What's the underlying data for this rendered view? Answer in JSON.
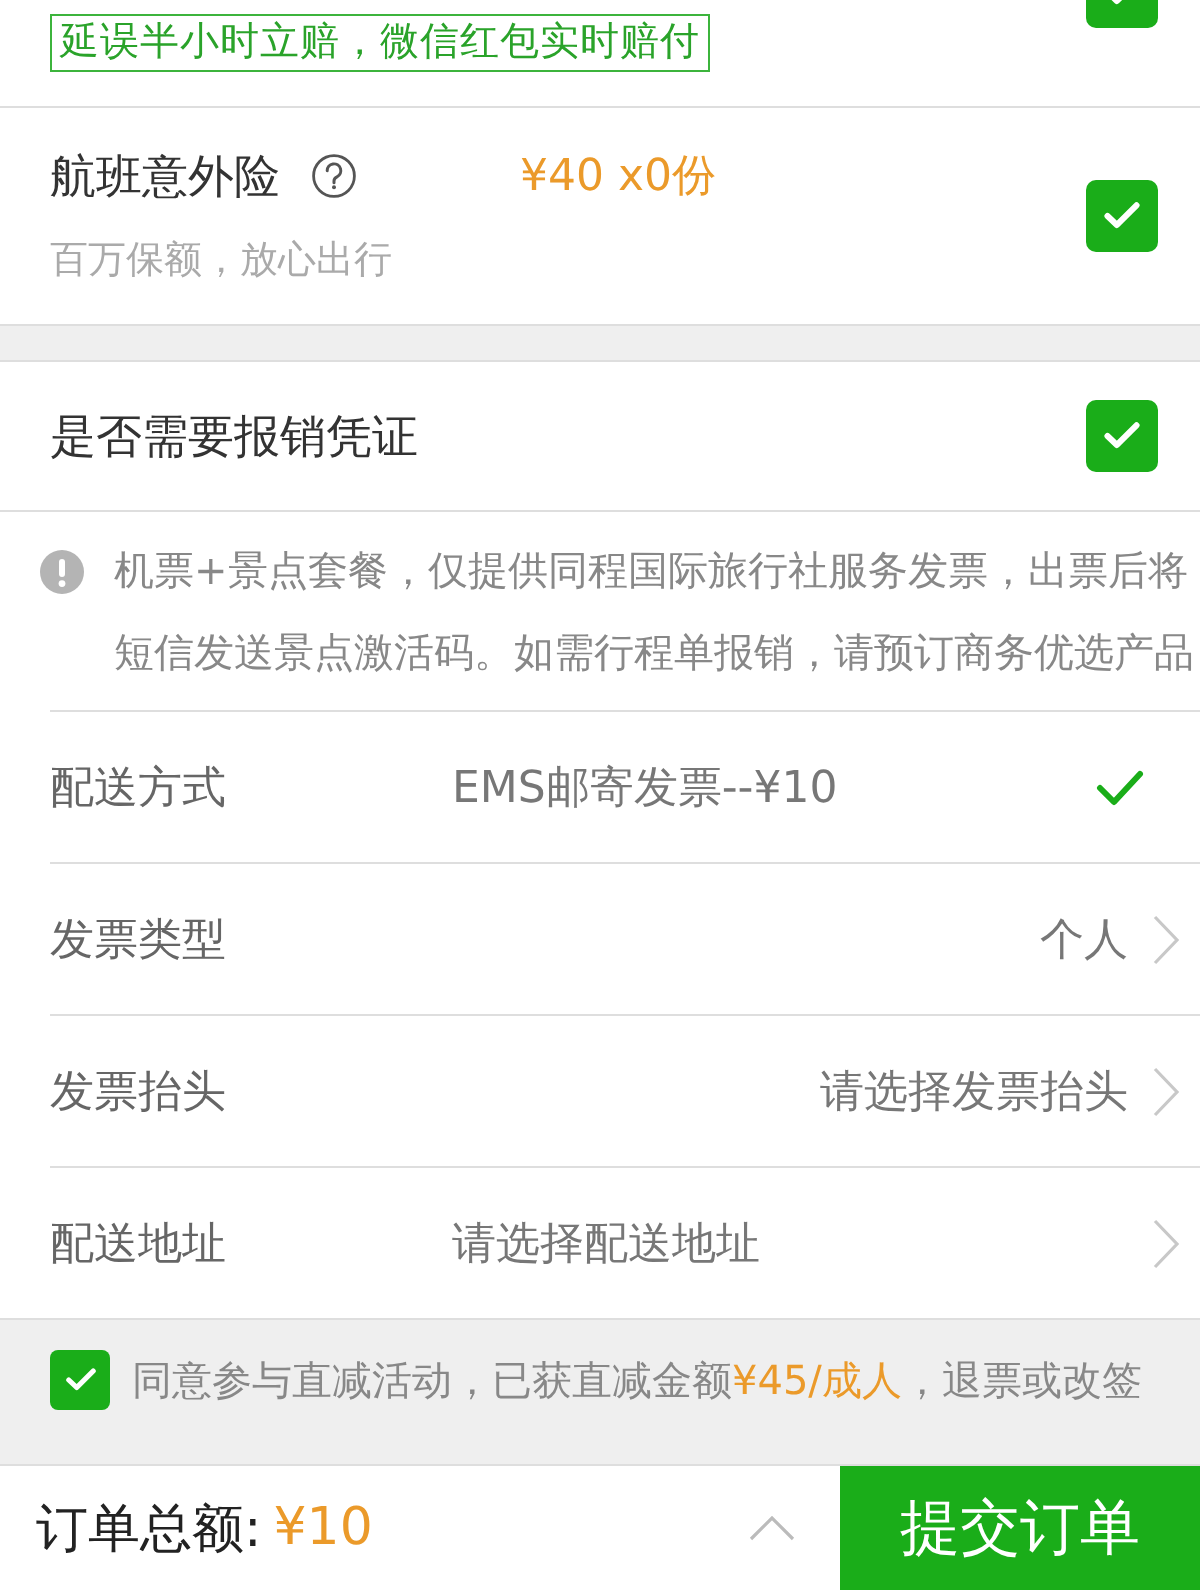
{
  "delay_compensation": {
    "tag": "延误半小时立赔，微信红包实时赔付",
    "checked": true
  },
  "accident_insurance": {
    "title": "航班意外险",
    "price": "¥40 x0份",
    "subtitle": "百万保额，放心出行",
    "checked": true
  },
  "reimbursement": {
    "label": "是否需要报销凭证",
    "checked": true
  },
  "notice": "机票+景点套餐，仅提供同程国际旅行社服务发票，出票后将短信发送景点激活码。如需行程单报销，请预订商务优选产品",
  "invoice_rows": [
    {
      "kind": "option",
      "label": "配送方式",
      "value": "EMS邮寄发票--¥10"
    },
    {
      "kind": "select",
      "label": "发票类型",
      "value": "个人"
    },
    {
      "kind": "select",
      "label": "发票抬头",
      "value": "请选择发票抬头"
    },
    {
      "kind": "entry",
      "label": "配送地址",
      "value": "请选择配送地址"
    }
  ],
  "agreement": {
    "checked": true,
    "parts": [
      {
        "text": "同意参与直减活动，已获直减金额",
        "highlight": false
      },
      {
        "text": "¥45/成人",
        "highlight": true
      },
      {
        "text": "，退票或改签",
        "highlight": false
      }
    ]
  },
  "footer": {
    "total_label": "订单总额:",
    "total": "¥10",
    "submit": "提交订单"
  }
}
